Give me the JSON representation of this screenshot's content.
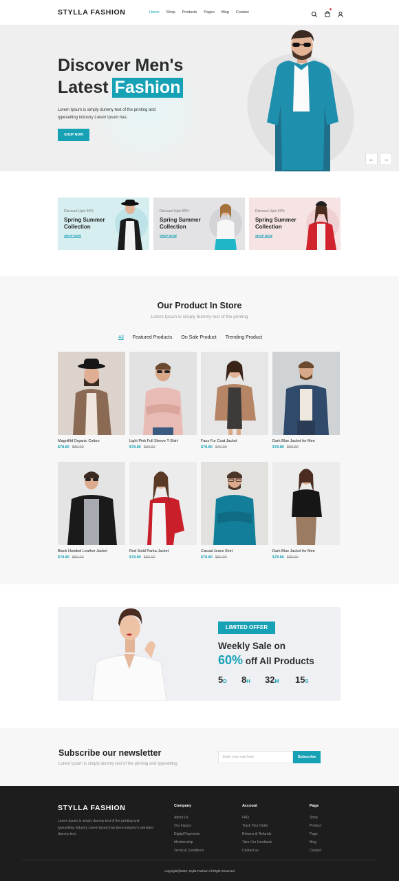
{
  "header": {
    "logo": "STYLLA FASHION",
    "nav": [
      "Home",
      "Shop",
      "Products",
      "Pages",
      "Blog",
      "Contact"
    ],
    "active_nav": "Home",
    "icons": [
      "search-icon",
      "cart-icon",
      "user-icon"
    ]
  },
  "hero": {
    "title_line1": "Discover Men's",
    "title_line2_plain": "Latest",
    "title_line2_highlight": "Fashion",
    "description": "Lorem Ipsum is simply dummy text of the printing and typesetting industry Lorem Ipsum has.",
    "button": "SHOP NOW",
    "prev_arrow": "←",
    "next_arrow": "→"
  },
  "promos": [
    {
      "subtitle": "Discount Upto 50%",
      "title": "Spring Summer Collection",
      "link": "SHOP NOW",
      "bg": "#d7eef0"
    },
    {
      "subtitle": "Discount Upto 50%",
      "title": "Spring Summer Collection",
      "link": "SHOP NOW",
      "bg": "#e3e3e6"
    },
    {
      "subtitle": "Discount Upto 50%",
      "title": "Spring Summer Collection",
      "link": "SHOP NOW",
      "bg": "#f6e3e4"
    }
  ],
  "store": {
    "title": "Our Product In Store",
    "subtitle": "Lorem Ipsum is simply dummy text of the printing",
    "filters": [
      "All",
      "Featured Products",
      "On Sale Product",
      "Trending Product"
    ],
    "active_filter": "All",
    "products": [
      {
        "name": "Magnifild Organic Cotton",
        "price": "$78.80",
        "old_price": "$80.00"
      },
      {
        "name": "Light Pink Full Sleeve T-Shirt",
        "price": "$78.80",
        "old_price": "$80.00"
      },
      {
        "name": "Faux Fur Coat Jacket",
        "price": "$78.80",
        "old_price": "$49.00"
      },
      {
        "name": "Dark Blue Jacket for Men",
        "price": "$78.80",
        "old_price": "$80.00"
      },
      {
        "name": "Black Hooded Leather Jacket",
        "price": "$78.80",
        "old_price": "$80.00"
      },
      {
        "name": "Red Solid Parka Jacket",
        "price": "$78.80",
        "old_price": "$80.00"
      },
      {
        "name": "Casual Jeans Shirt",
        "price": "$78.80",
        "old_price": "$80.00"
      },
      {
        "name": "Dark Blue Jacket for Men",
        "price": "$78.80",
        "old_price": "$80.00"
      }
    ]
  },
  "offer": {
    "badge": "LIMITED OFFER",
    "line1": "Weekly Sale on",
    "percent": "60%",
    "line2_rest": "off All Products",
    "countdown": [
      {
        "value": "5",
        "unit": "D"
      },
      {
        "value": "8",
        "unit": "H"
      },
      {
        "value": "32",
        "unit": "M"
      },
      {
        "value": "15",
        "unit": "S"
      }
    ]
  },
  "newsletter": {
    "title": "Subscribe our newsletter",
    "subtitle": "Lorem Ipsum is simply dummy text of the printing and typesetting",
    "placeholder": "Enter your mail here",
    "button": "Subscribe"
  },
  "footer": {
    "logo": "STYLLA FASHION",
    "description": "Lorem Ipsum is simply dummy text of the printing and typesetting industry Lorem Ipsum has been industry's standard dummy text.",
    "columns": [
      {
        "heading": "Company",
        "items": [
          "About Us",
          "Our Impact",
          "Digital Payments",
          "Membership",
          "Terms & Conditions"
        ]
      },
      {
        "heading": "Account",
        "items": [
          "FAQ",
          "Track Your Order",
          "Returns & Refunds",
          "Take Our Feedback",
          "Contact us"
        ]
      },
      {
        "heading": "Page",
        "items": [
          "Shop",
          "Product",
          "Page",
          "Blog",
          "Contact"
        ]
      }
    ],
    "copyright": "copyright@2022, Stylla Fashion All Right Reserved"
  },
  "colors": {
    "accent": "#16a1b5",
    "dark": "#1d1d1d",
    "text": "#222222"
  }
}
